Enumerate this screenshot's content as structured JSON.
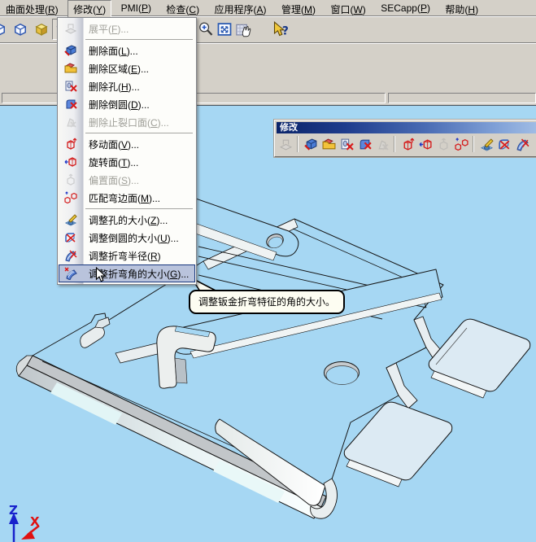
{
  "colors": {
    "viewport_bg": "#A6D7F3",
    "chrome_bg": "#D4D0C8",
    "caption_gradient_start": "#0A246A",
    "caption_gradient_end": "#A9C4E8",
    "menu_highlight_bg": "#B9C3DC",
    "menu_highlight_border": "#17377E",
    "disabled_text": "#9F9F98",
    "axis_z_color": "#1822CC",
    "axis_x_color": "#E01010"
  },
  "menubar": {
    "items": [
      {
        "name": "menu-surface-processing",
        "pre": "曲面处理(",
        "key": "R",
        "post": ")"
      },
      {
        "name": "menu-modify",
        "pre": "修改(",
        "key": "Y",
        "post": ")",
        "pressed": true
      },
      {
        "name": "menu-pmi",
        "pre": "PMI(",
        "key": "P",
        "post": ")"
      },
      {
        "name": "menu-inspect",
        "pre": "检查(",
        "key": "C",
        "post": ")"
      },
      {
        "name": "menu-applications",
        "pre": "应用程序(",
        "key": "A",
        "post": ")"
      },
      {
        "name": "menu-manage",
        "pre": "管理(",
        "key": "M",
        "post": ")"
      },
      {
        "name": "menu-window",
        "pre": "窗口(",
        "key": "W",
        "post": ")"
      },
      {
        "name": "menu-secapp",
        "pre": "SECapp(",
        "key": "P",
        "post": ")"
      },
      {
        "name": "menu-help",
        "pre": "帮助(",
        "key": "H",
        "post": ")"
      }
    ]
  },
  "toolbar_top": {
    "view_buttons": [
      {
        "name": "view-style-wireframe",
        "icon": "cube-wire"
      },
      {
        "name": "view-style-hidden-edges",
        "icon": "cube-wire"
      },
      {
        "name": "view-style-shaded",
        "icon": "cube-shaded"
      },
      {
        "name": "view-style-shaded-edges",
        "icon": "cube-blue",
        "pressed": true
      }
    ],
    "right_buttons": [
      {
        "name": "zoom-area",
        "icon": "zoom-in"
      },
      {
        "name": "fit-view",
        "icon": "fit"
      },
      {
        "name": "pan",
        "icon": "pan"
      },
      {
        "type": "separator"
      },
      {
        "name": "context-help",
        "icon": "help-select"
      }
    ]
  },
  "dropdown_menu": {
    "items": [
      {
        "name": "menu-item-flatten",
        "icon": "flatten",
        "pre": "展平(",
        "key": "F",
        "post": ")...",
        "disabled": true
      },
      {
        "type": "separator"
      },
      {
        "name": "menu-item-delete-face",
        "icon": "delete-face",
        "pre": "删除面(",
        "key": "L",
        "post": ")..."
      },
      {
        "name": "menu-item-delete-region",
        "icon": "delete-region",
        "pre": "删除区域(",
        "key": "E",
        "post": ")..."
      },
      {
        "name": "menu-item-delete-hole",
        "icon": "delete-hole",
        "pre": "删除孔(",
        "key": "H",
        "post": ")..."
      },
      {
        "name": "menu-item-delete-round",
        "icon": "delete-round",
        "pre": "删除倒圆(",
        "key": "D",
        "post": ")..."
      },
      {
        "name": "menu-item-delete-rip-face",
        "icon": "delete-rip-face",
        "pre": "删除止裂口面(",
        "key": "C",
        "post": ")...",
        "disabled": true
      },
      {
        "type": "separator"
      },
      {
        "name": "menu-item-move-face",
        "icon": "move-face",
        "pre": "移动面(",
        "key": "V",
        "post": ")..."
      },
      {
        "name": "menu-item-rotate-face",
        "icon": "rotate-face",
        "pre": "旋转面(",
        "key": "T",
        "post": ")..."
      },
      {
        "name": "menu-item-offset-face",
        "icon": "offset-face",
        "pre": "偏置面(",
        "key": "S",
        "post": ")...",
        "disabled": true
      },
      {
        "name": "menu-item-match-flange-face",
        "icon": "match-flange",
        "pre": "匹配弯边面(",
        "key": "M",
        "post": ")..."
      },
      {
        "type": "separator"
      },
      {
        "name": "menu-item-resize-hole",
        "icon": "resize-hole",
        "pre": "调整孔的大小(",
        "key": "Z",
        "post": ")..."
      },
      {
        "name": "menu-item-resize-round",
        "icon": "resize-round",
        "pre": "调整倒圆的大小(",
        "key": "U",
        "post": ")..."
      },
      {
        "name": "menu-item-bend-radius",
        "icon": "bend-radius",
        "pre": "调整折弯半径(",
        "key": "R",
        "post": ")"
      },
      {
        "name": "menu-item-bend-angle",
        "icon": "bend-angle",
        "pre": "调整折弯角的大小(",
        "key": "G",
        "post": ")...",
        "highlight": true
      }
    ]
  },
  "floating_toolbar": {
    "title": "修改",
    "icons": [
      {
        "name": "tb-flatten",
        "icon": "flatten",
        "disabled": true
      },
      {
        "type": "separator"
      },
      {
        "name": "tb-delete-face",
        "icon": "delete-face"
      },
      {
        "name": "tb-delete-region",
        "icon": "delete-region"
      },
      {
        "name": "tb-delete-hole",
        "icon": "delete-hole"
      },
      {
        "name": "tb-delete-round",
        "icon": "delete-round"
      },
      {
        "name": "tb-delete-rip-face",
        "icon": "delete-rip-face",
        "disabled": true
      },
      {
        "type": "separator"
      },
      {
        "name": "tb-move-face",
        "icon": "move-face"
      },
      {
        "name": "tb-rotate-face",
        "icon": "rotate-face"
      },
      {
        "name": "tb-offset-face",
        "icon": "offset-face",
        "disabled": true
      },
      {
        "name": "tb-match-flange-face",
        "icon": "match-flange"
      },
      {
        "type": "separator"
      },
      {
        "name": "tb-resize-hole",
        "icon": "resize-hole"
      },
      {
        "name": "tb-resize-round",
        "icon": "resize-round"
      },
      {
        "name": "tb-bend-radius",
        "icon": "bend-radius"
      }
    ]
  },
  "tooltip": {
    "text": "调整钣金折弯特征的角的大小。"
  },
  "axes": {
    "z_label": "Z",
    "x_label": "X"
  }
}
